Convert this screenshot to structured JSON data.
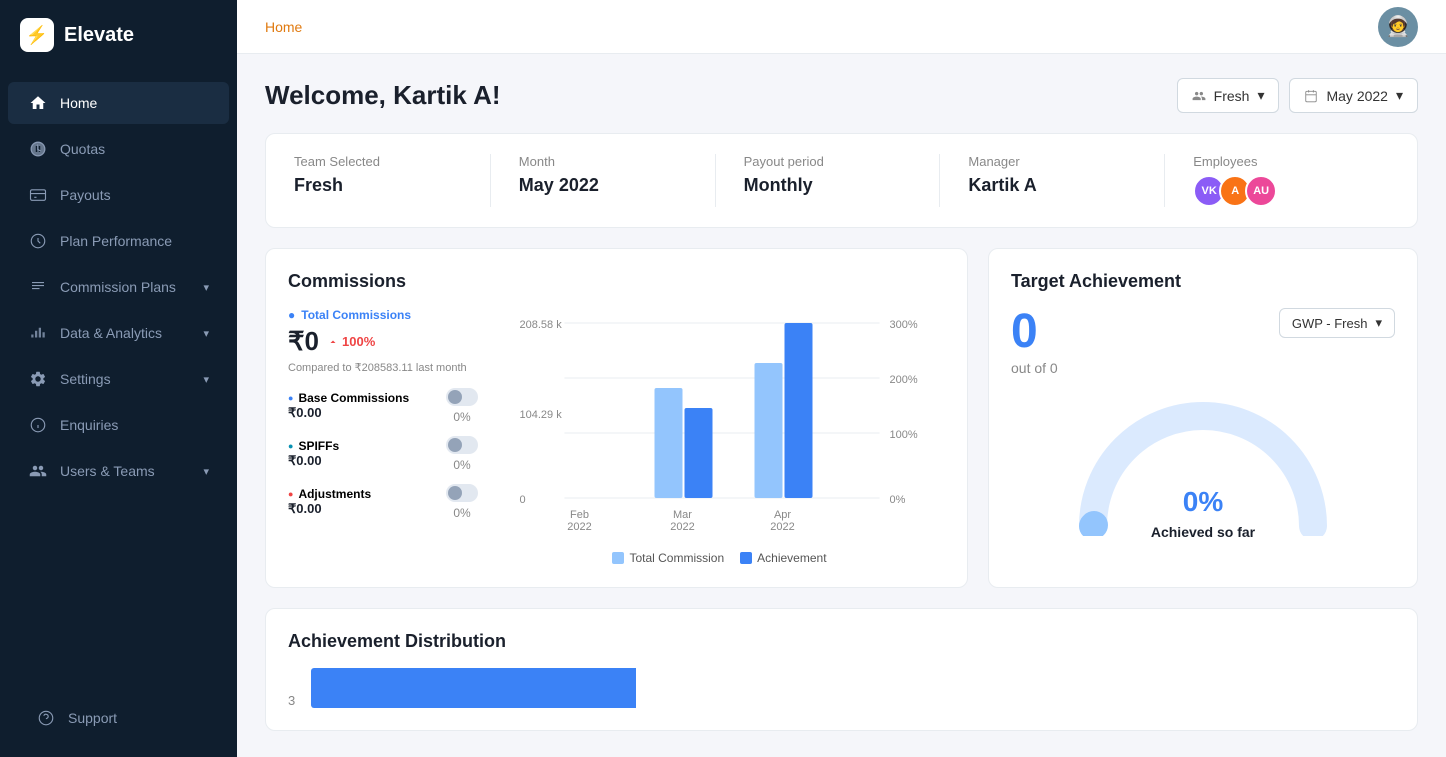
{
  "app": {
    "name": "Elevate",
    "logo_icon": "⚡"
  },
  "sidebar": {
    "items": [
      {
        "id": "home",
        "label": "Home",
        "icon": "⌂",
        "active": true,
        "has_arrow": false
      },
      {
        "id": "quotas",
        "label": "Quotas",
        "icon": "◷",
        "active": false,
        "has_arrow": false
      },
      {
        "id": "payouts",
        "label": "Payouts",
        "icon": "▦",
        "active": false,
        "has_arrow": false
      },
      {
        "id": "plan-performance",
        "label": "Plan Performance",
        "icon": "◎",
        "active": false,
        "has_arrow": false
      },
      {
        "id": "commission-plans",
        "label": "Commission Plans",
        "icon": "☰",
        "active": false,
        "has_arrow": true
      },
      {
        "id": "data-analytics",
        "label": "Data & Analytics",
        "icon": "⑆",
        "active": false,
        "has_arrow": true
      },
      {
        "id": "settings",
        "label": "Settings",
        "icon": "⚙",
        "active": false,
        "has_arrow": true
      },
      {
        "id": "enquiries",
        "label": "Enquiries",
        "icon": "?",
        "active": false,
        "has_arrow": false
      },
      {
        "id": "users-teams",
        "label": "Users & Teams",
        "icon": "👤",
        "active": false,
        "has_arrow": true
      }
    ],
    "bottom_items": [
      {
        "id": "support",
        "label": "Support",
        "icon": "💬"
      }
    ]
  },
  "topbar": {
    "breadcrumb": "Home"
  },
  "page": {
    "title": "Welcome, Kartik A!"
  },
  "filters": {
    "team_label": "Fresh",
    "team_icon": "👥",
    "period_label": "May 2022",
    "period_icon": "📅"
  },
  "summary": {
    "team_selected_label": "Team Selected",
    "team_selected_value": "Fresh",
    "month_label": "Month",
    "month_value": "May 2022",
    "payout_period_label": "Payout period",
    "payout_period_value": "Monthly",
    "manager_label": "Manager",
    "manager_value": "Kartik A",
    "employees_label": "Employees",
    "employees": [
      {
        "initials": "VK",
        "color": "#8b5cf6"
      },
      {
        "initials": "A",
        "color": "#f97316"
      },
      {
        "initials": "AU",
        "color": "#ec4899"
      }
    ]
  },
  "commissions": {
    "section_title": "Commissions",
    "total_label": "Total Commissions",
    "total_amount": "₹0",
    "total_pct": "100%",
    "compared_text": "Compared to ₹208583.11 last month",
    "stats": [
      {
        "name": "Base Commissions",
        "amount": "₹0.00",
        "pct": "0%",
        "color": "blue"
      },
      {
        "name": "SPIFFs",
        "amount": "₹0.00",
        "pct": "0%",
        "color": "teal"
      },
      {
        "name": "Adjustments",
        "amount": "₹0.00",
        "pct": "0%",
        "color": "red"
      }
    ],
    "chart": {
      "y_labels": [
        "208.58 k",
        "104.29 k",
        "0"
      ],
      "y_right_labels": [
        "300%",
        "200%",
        "100%",
        "0%"
      ],
      "bars": [
        {
          "month": "Feb\n2022",
          "commission": 0,
          "achievement": 0
        },
        {
          "month": "Mar\n2022",
          "commission": 65,
          "achievement": 45
        },
        {
          "month": "Apr\n2022",
          "commission": 85,
          "achievement": 90
        }
      ],
      "legend": [
        {
          "label": "Total Commission",
          "color": "#93c5fd"
        },
        {
          "label": "Achievement",
          "color": "#3b82f6"
        }
      ]
    }
  },
  "target_achievement": {
    "section_title": "Target Achievement",
    "value": "0",
    "out_of": "out of 0",
    "dropdown_label": "GWP - Fresh",
    "gauge_pct": "0%",
    "gauge_label": "Achieved so far"
  },
  "achievement_distribution": {
    "section_title": "Achievement Distribution",
    "y_value": "3"
  }
}
